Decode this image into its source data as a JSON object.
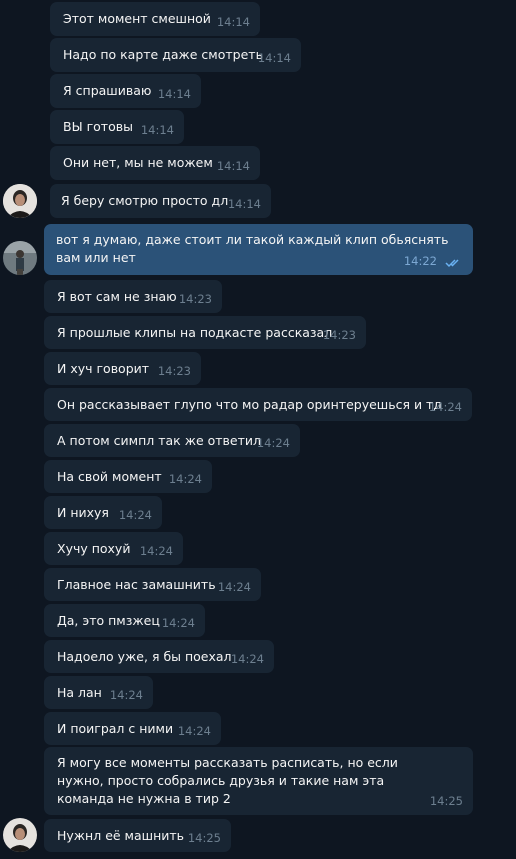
{
  "messages": [
    {
      "text": "Этот момент смешной",
      "time": "14:14"
    },
    {
      "text": "Надо по карте даже смотреть",
      "time": "14:14"
    },
    {
      "text": "Я спрашиваю",
      "time": "14:14"
    },
    {
      "text": "ВЫ готовы",
      "time": "14:14"
    },
    {
      "text": "Они нет, мы не можем",
      "time": "14:14"
    },
    {
      "text": "Я беру смотрю просто дл",
      "time": "14:14"
    },
    {
      "text": "вот я думаю, даже стоит ли такой каждый клип обьяснять вам или нет",
      "time": "14:22"
    },
    {
      "text": "Я вот сам не знаю",
      "time": "14:23"
    },
    {
      "text": "Я прошлые клипы на подкасте рассказал",
      "time": "14:23"
    },
    {
      "text": "И хуч говорит",
      "time": "14:23"
    },
    {
      "text": "Он рассказывает глупо что мо радар оринтеруешься и тд",
      "time": "14:24"
    },
    {
      "text": "А потом симпл так же ответил",
      "time": "14:24"
    },
    {
      "text": "На свой момент",
      "time": "14:24"
    },
    {
      "text": "И нихуя",
      "time": "14:24"
    },
    {
      "text": "Хучу похуй",
      "time": "14:24"
    },
    {
      "text": "Главное нас замашнить",
      "time": "14:24"
    },
    {
      "text": "Да, это пмзжец",
      "time": "14:24"
    },
    {
      "text": "Надоело уже, я бы поехал",
      "time": "14:24"
    },
    {
      "text": "На лан",
      "time": "14:24"
    },
    {
      "text": "И поиграл с ними",
      "time": "14:24"
    },
    {
      "text": "Я могу все моменты рассказать расписать, но если нужно, просто собрались друзья и такие нам эта команда не нужна в тир 2",
      "time": "14:25"
    },
    {
      "text": "Нужнл её машнить",
      "time": "14:25"
    }
  ],
  "colors": {
    "background": "#0e1621",
    "incoming": "#182533",
    "outgoing": "#2b5278",
    "read_check": "#6ab2f2"
  },
  "icons": {
    "read_status": "double-check-icon"
  }
}
